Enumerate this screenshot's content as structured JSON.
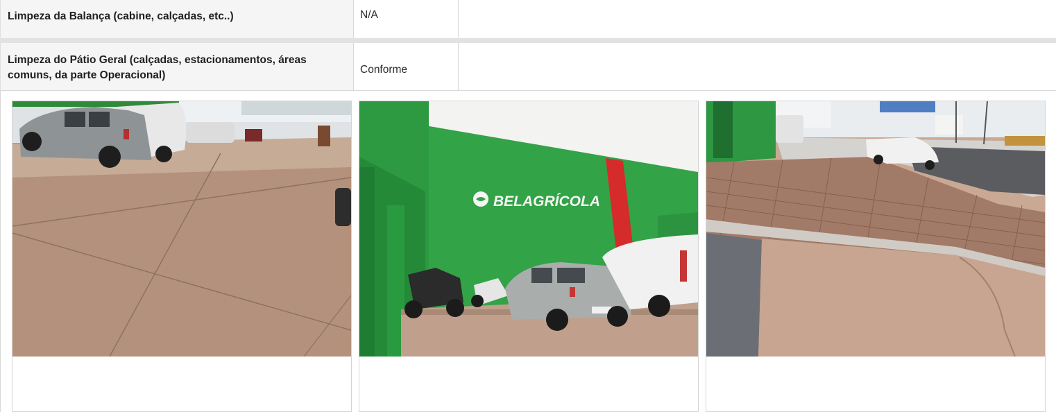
{
  "rows": [
    {
      "label": "Limpeza da Balança (cabine, calçadas, etc..)",
      "status": "N/A"
    },
    {
      "label": "Limpeza do Pátio Geral (calçadas, estacionamentos, áreas comuns, da parte Operacional)",
      "status": "Conforme"
    }
  ],
  "photos": [
    {
      "scene": "parking-lot-concrete-floor"
    },
    {
      "scene": "green-building-facade-with-logo",
      "sign_text": "BELAGRÍCOLA"
    },
    {
      "scene": "cobblestone-sidewalk-street"
    }
  ]
}
